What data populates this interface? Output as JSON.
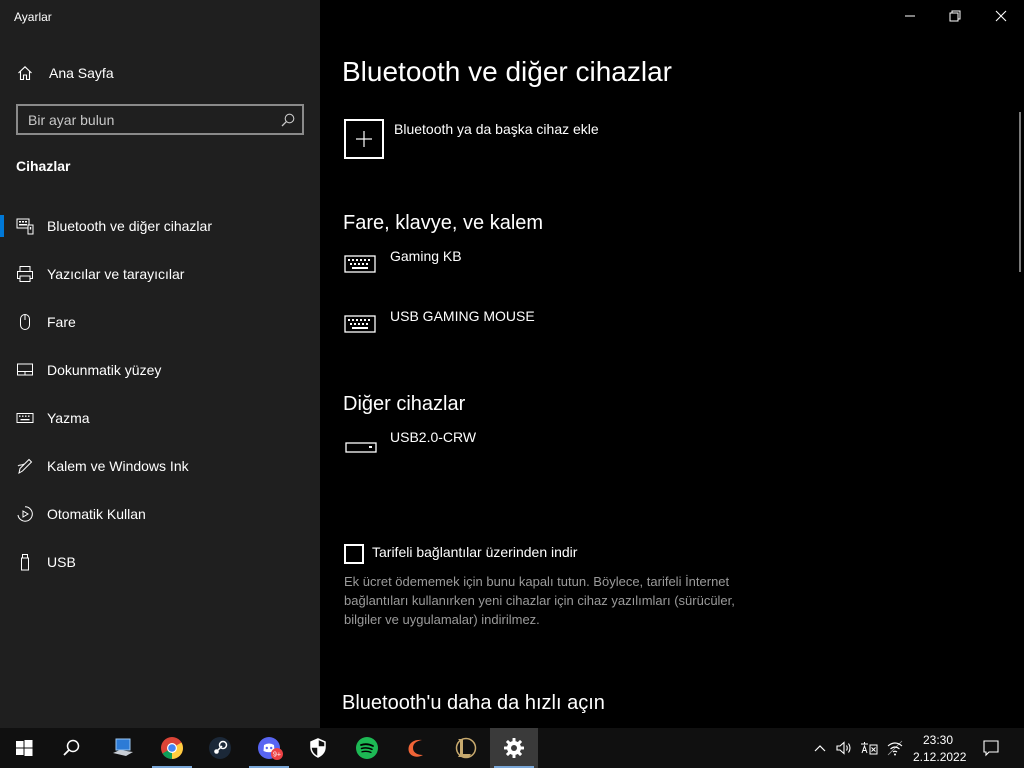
{
  "window": {
    "title": "Ayarlar",
    "controls": {
      "minimize_icon": "minimize-icon",
      "restore_icon": "restore-icon",
      "close_icon": "close-icon"
    }
  },
  "sidebar": {
    "home": {
      "label": "Ana Sayfa",
      "icon": "home-icon"
    },
    "search": {
      "placeholder": "Bir ayar bulun",
      "value": "",
      "icon": "search-icon"
    },
    "section": "Cihazlar",
    "items": [
      {
        "label": "Bluetooth ve diğer cihazlar",
        "icon": "bluetooth-devices-icon",
        "selected": true
      },
      {
        "label": "Yazıcılar ve tarayıcılar",
        "icon": "printer-icon",
        "selected": false
      },
      {
        "label": "Fare",
        "icon": "mouse-icon",
        "selected": false
      },
      {
        "label": "Dokunmatik yüzey",
        "icon": "touchpad-icon",
        "selected": false
      },
      {
        "label": "Yazma",
        "icon": "keyboard-icon",
        "selected": false
      },
      {
        "label": "Kalem ve Windows Ink",
        "icon": "pen-icon",
        "selected": false
      },
      {
        "label": "Otomatik Kullan",
        "icon": "autoplay-icon",
        "selected": false
      },
      {
        "label": "USB",
        "icon": "usb-icon",
        "selected": false
      }
    ]
  },
  "main": {
    "title": "Bluetooth ve diğer cihazlar",
    "add_device": {
      "label": "Bluetooth ya da başka cihaz ekle",
      "icon": "plus-icon"
    },
    "groups": [
      {
        "heading": "Fare, klavye, ve kalem",
        "devices": [
          {
            "name": "Gaming KB",
            "icon": "keyboard-icon"
          },
          {
            "name": "USB GAMING MOUSE",
            "icon": "keyboard-icon"
          }
        ]
      },
      {
        "heading": "Diğer cihazlar",
        "devices": [
          {
            "name": "USB2.0-CRW",
            "icon": "generic-device-icon"
          }
        ]
      }
    ],
    "metered": {
      "label": "Tarifeli bağlantılar üzerinden indir",
      "checked": false,
      "description": "Ek ücret ödememek için bunu kapalı tutun. Böylece, tarifeli İnternet bağlantıları kullanırken yeni cihazlar için cihaz yazılımları (sürücüler, bilgiler ve uygulamalar) indirilmez."
    },
    "bottom_heading": "Bluetooth'u daha da hızlı açın"
  },
  "taskbar": {
    "apps": [
      {
        "icon": "windows-start-icon"
      },
      {
        "icon": "search-icon"
      },
      {
        "icon": "desktop-computer-icon"
      },
      {
        "icon": "chrome-icon"
      },
      {
        "icon": "steam-icon"
      },
      {
        "icon": "discord-icon",
        "badge": "9+"
      },
      {
        "icon": "shield-icon"
      },
      {
        "icon": "spotify-icon"
      },
      {
        "icon": "curseforge-icon"
      },
      {
        "icon": "league-of-legends-icon"
      },
      {
        "icon": "settings-gear-icon",
        "active": true
      }
    ],
    "tray": [
      "chevron-up-icon",
      "volume-icon",
      "ime-icon",
      "wifi-icon"
    ],
    "clock": {
      "time": "23:30",
      "date": "2.12.2022"
    },
    "notification_icon": "notification-icon"
  },
  "colors": {
    "sidebar_bg": "#1f1f1f",
    "main_bg": "#000000",
    "accent": "#0078d7",
    "taskbar_bg": "#101010"
  }
}
